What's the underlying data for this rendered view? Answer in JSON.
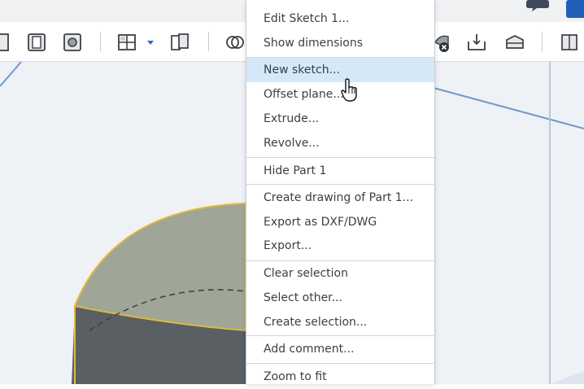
{
  "menu": {
    "items": [
      {
        "label": "Edit Sketch 1..."
      },
      {
        "label": "Show dimensions"
      },
      {
        "label": "New sketch..."
      },
      {
        "label": "Offset plane..."
      },
      {
        "label": "Extrude..."
      },
      {
        "label": "Revolve..."
      },
      {
        "label": "Hide Part 1"
      },
      {
        "label": "Create drawing of Part 1..."
      },
      {
        "label": "Export as DXF/DWG"
      },
      {
        "label": "Export..."
      },
      {
        "label": "Clear selection"
      },
      {
        "label": "Select other..."
      },
      {
        "label": "Create selection..."
      },
      {
        "label": "Add comment..."
      },
      {
        "label": "Zoom to fit"
      }
    ],
    "highlighted": "New sketch..."
  },
  "toolbar": {
    "icons": [
      "face-icon",
      "shell-icon",
      "hole-icon",
      "pattern-icon",
      "dropdown-arrow-icon",
      "mirror-icon",
      "boolean-icon",
      "delete-part-icon",
      "extrude-plane-icon",
      "fillet-plane-icon",
      "view-cube-icon"
    ]
  },
  "colors": {
    "accent": "#1f5fb7",
    "highlight": "#d5e8f8",
    "part_top": "#9fa597",
    "part_side": "#5a5f63",
    "edge_highlight": "#e0b93a"
  }
}
